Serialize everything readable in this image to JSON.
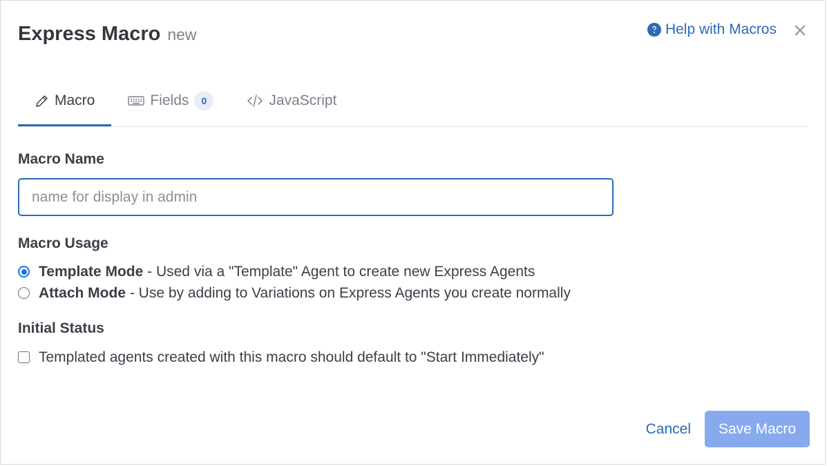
{
  "header": {
    "title": "Express Macro",
    "title_suffix": "new",
    "help_label": "Help with Macros",
    "help_icon": "question-circle-icon",
    "close_icon": "close-icon"
  },
  "tabs": [
    {
      "label": "Macro",
      "icon": "pencil-icon",
      "active": true
    },
    {
      "label": "Fields",
      "icon": "keyboard-icon",
      "badge": "0",
      "active": false
    },
    {
      "label": "JavaScript",
      "icon": "code-icon",
      "active": false
    }
  ],
  "form": {
    "macro_name": {
      "label": "Macro Name",
      "value": "",
      "placeholder": "name for display in admin"
    },
    "usage": {
      "label": "Macro Usage",
      "selected": "template",
      "options": [
        {
          "name": "Template Mode",
          "description": " - Used via a \"Template\" Agent to create new Express Agents"
        },
        {
          "name": "Attach Mode",
          "description": " - Use by adding to Variations on Express Agents you create normally"
        }
      ]
    },
    "initial_status": {
      "label": "Initial Status",
      "checkbox_label": "Templated agents created with this macro should default to \"Start Immediately\"",
      "checked": false
    }
  },
  "footer": {
    "cancel_label": "Cancel",
    "save_label": "Save Macro"
  },
  "colors": {
    "accent": "#2a6ab5",
    "radio_selected": "#1a73e8",
    "save_button_disabled": "#86aaed"
  }
}
